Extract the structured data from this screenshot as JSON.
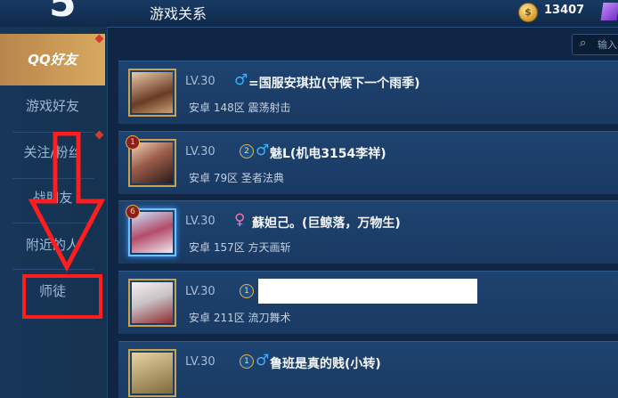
{
  "header": {
    "back_glyph": "5",
    "title": "游戏关系",
    "coin_glyph": "$",
    "coins": "13407"
  },
  "sidebar": {
    "items": [
      {
        "label": "QQ好友",
        "active": true
      },
      {
        "label": "游戏好友",
        "active": false
      },
      {
        "label": "关注/粉丝",
        "active": false
      },
      {
        "label": "战朋友",
        "active": false
      },
      {
        "label": "附近的人",
        "active": false
      },
      {
        "label": "师徒",
        "active": false
      }
    ]
  },
  "search": {
    "icon": "search-icon",
    "placeholder": "输入"
  },
  "friends": [
    {
      "level": "LV.30",
      "gender": "♂",
      "name": "=国服安琪拉(守候下一个雨季)",
      "meta": "安卓 148区 震荡射击"
    },
    {
      "level": "LV.30",
      "rank": "1",
      "badge": "2",
      "gender": "♂",
      "name": "魅L(机电3154李祥)",
      "meta": "安卓 79区 圣者法典"
    },
    {
      "level": "LV.30",
      "rank": "6",
      "gender": "♀",
      "name": "蘇妲己。(巨鲸落，万物生)",
      "meta": "安卓 157区 方天画斩"
    },
    {
      "level": "LV.30",
      "badge": "1",
      "name": "",
      "meta": "安卓 211区 流刀舞术"
    },
    {
      "level": "LV.30",
      "badge": "1",
      "gender": "♂",
      "name": "鲁班是真的贱(小转)",
      "meta": ""
    }
  ],
  "colors": {
    "accent": "#d8a95f",
    "annotation": "#ff1d1d",
    "male": "#3ab0ff",
    "female": "#ff6fb0"
  }
}
